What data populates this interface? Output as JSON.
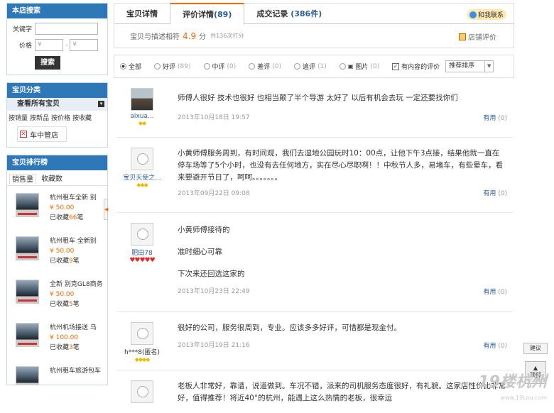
{
  "sidebar": {
    "search": {
      "title": "本店搜索",
      "keyword_label": "关键字",
      "price_label": "价格",
      "min_placeholder": "¥",
      "max_placeholder": "¥",
      "sep": "-",
      "button": "搜索"
    },
    "categories": {
      "title": "宝贝分类",
      "all": "查看所有宝贝",
      "sorts": [
        "按销量",
        "按新品",
        "按价格",
        "按收藏"
      ],
      "shop_name": "车中管店"
    },
    "ranking": {
      "title": "宝贝排行榜",
      "tabs": [
        "销售量",
        "收藏数"
      ],
      "items": [
        {
          "name": "杭州租车全新 别",
          "price": "¥ 50.00",
          "fav_prefix": "已收藏",
          "fav_count": "66",
          "fav_suffix": "笔"
        },
        {
          "name": "杭州租车 全新别",
          "price": "¥ 50.00",
          "fav_prefix": "已收藏",
          "fav_count": "9",
          "fav_suffix": "笔"
        },
        {
          "name": "全新 别克GL8商务",
          "price": "¥ 50.00",
          "fav_prefix": "已收藏",
          "fav_count": "5",
          "fav_suffix": "笔"
        },
        {
          "name": "杭州机场接送 乌",
          "price": "¥ 100.00",
          "fav_prefix": "已收藏",
          "fav_count": "3",
          "fav_suffix": "笔"
        },
        {
          "name": "杭州租车旅游包车",
          "price": "",
          "fav_prefix": "",
          "fav_count": "",
          "fav_suffix": ""
        }
      ]
    }
  },
  "tabs": {
    "details": "宝贝详情",
    "reviews": "评价详情",
    "reviews_count": "(89)",
    "deals": "成交记录",
    "deals_count": "(386件)",
    "contact": "和我联系"
  },
  "score": {
    "label": "宝贝与描述相符",
    "value": "4.9",
    "unit": "分",
    "count": "共136次打分",
    "store_rate": "店铺评价"
  },
  "filter": {
    "options": [
      {
        "label": "全部",
        "count": "",
        "selected": true
      },
      {
        "label": "好评",
        "count": "(89)",
        "selected": false
      },
      {
        "label": "中评",
        "count": "(0)",
        "selected": false
      },
      {
        "label": "差评",
        "count": "(0)",
        "selected": false
      },
      {
        "label": "追评",
        "count": "(1)",
        "selected": false
      },
      {
        "label": "图片",
        "count": "(0)",
        "selected": false
      }
    ],
    "has_content": "有内容的评价",
    "has_content_checked": true,
    "sort": "推荐排序"
  },
  "reviews": [
    {
      "user": "aixua...",
      "text": "师傅人很好 技术也很好 也相当颠了半个导游 太好了 以后有机会去玩 一定还要找你们",
      "date": "2013年10月18日 19:57",
      "useful": "有用",
      "useful_count": "(0)",
      "badge": "◆◆"
    },
    {
      "user": "宝贝天使之...",
      "text": "小黄师傅服务周到，有时间观，我们去湿地公园玩时10：00点，让他下午3点接，结果他就一直在停车场等了5个小时，也没有去任何地方，实在尽心尽职啊！！中秋节人多，易堵车，有些晕车，看来要避开节日了，呵呵。。。。。。。",
      "date": "2013年09月22日 09:08",
      "useful": "有用",
      "useful_count": "(0)",
      "badge": "◆◆◆"
    },
    {
      "user": "肥田78",
      "lines": [
        "小黄师傅接待的",
        "准时细心可靠",
        "下次来还回选这家的"
      ],
      "date": "2013年10月23日 22:49",
      "useful": "有用",
      "useful_count": "(0)",
      "badge": "♥♥♥♥♥"
    },
    {
      "user": "h***8(匿名)",
      "text": "很好的公司，服务很周到，专业。应该多多好评，可惜都是现金付。",
      "date": "2013年10月19日 21:16",
      "useful": "有用",
      "useful_count": "(0)",
      "badge": "◆◆◆◆"
    },
    {
      "user": "",
      "text": "老板人非常好，靠谱，说道做到。车况不错，派来的司机服务态度很好，有礼貌。这家店性价比非常好，值得推荐！将近40°的杭州，能遇上这么热情的老板，很幸运",
      "date": "",
      "useful": "",
      "useful_count": "",
      "badge": ""
    }
  ],
  "side": {
    "suggest": "建议",
    "top": "顶部"
  },
  "watermark": {
    "main": "19楼杭州",
    "sub": "www.19Lou.com"
  },
  "colors": {
    "header_blue": "#2f78b8",
    "accent_orange": "#ff6600",
    "link_blue": "#2b5c9c"
  }
}
